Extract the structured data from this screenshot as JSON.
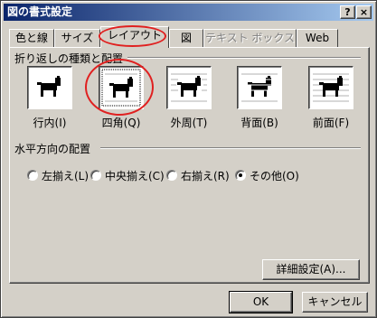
{
  "window": {
    "title": "図の書式設定",
    "help_button": "?",
    "close_button": "×"
  },
  "tabs": [
    {
      "label": "色と線",
      "active": false,
      "disabled": false
    },
    {
      "label": "サイズ",
      "active": false,
      "disabled": false
    },
    {
      "label": "レイアウト",
      "active": true,
      "disabled": false
    },
    {
      "label": "図",
      "active": false,
      "disabled": false
    },
    {
      "label": "テキスト ボックス",
      "active": false,
      "disabled": true
    },
    {
      "label": "Web",
      "active": false,
      "disabled": false
    }
  ],
  "wrapping": {
    "heading": "折り返しの種類と配置",
    "options": [
      {
        "label": "行内(I)",
        "selected": false
      },
      {
        "label": "四角(Q)",
        "selected": true
      },
      {
        "label": "外周(T)",
        "selected": false
      },
      {
        "label": "背面(B)",
        "selected": false
      },
      {
        "label": "前面(F)",
        "selected": false
      }
    ]
  },
  "horizontal_alignment": {
    "heading": "水平方向の配置",
    "options": [
      {
        "label": "左揃え(L)",
        "selected": false
      },
      {
        "label": "中央揃え(C)",
        "selected": false
      },
      {
        "label": "右揃え(R)",
        "selected": false
      },
      {
        "label": "その他(O)",
        "selected": true
      }
    ]
  },
  "buttons": {
    "advanced": "詳細設定(A)...",
    "ok": "OK",
    "cancel": "キャンセル"
  },
  "colors": {
    "titlebar": "#0a246a",
    "face": "#d4d0c8",
    "annotation": "#e02020"
  }
}
